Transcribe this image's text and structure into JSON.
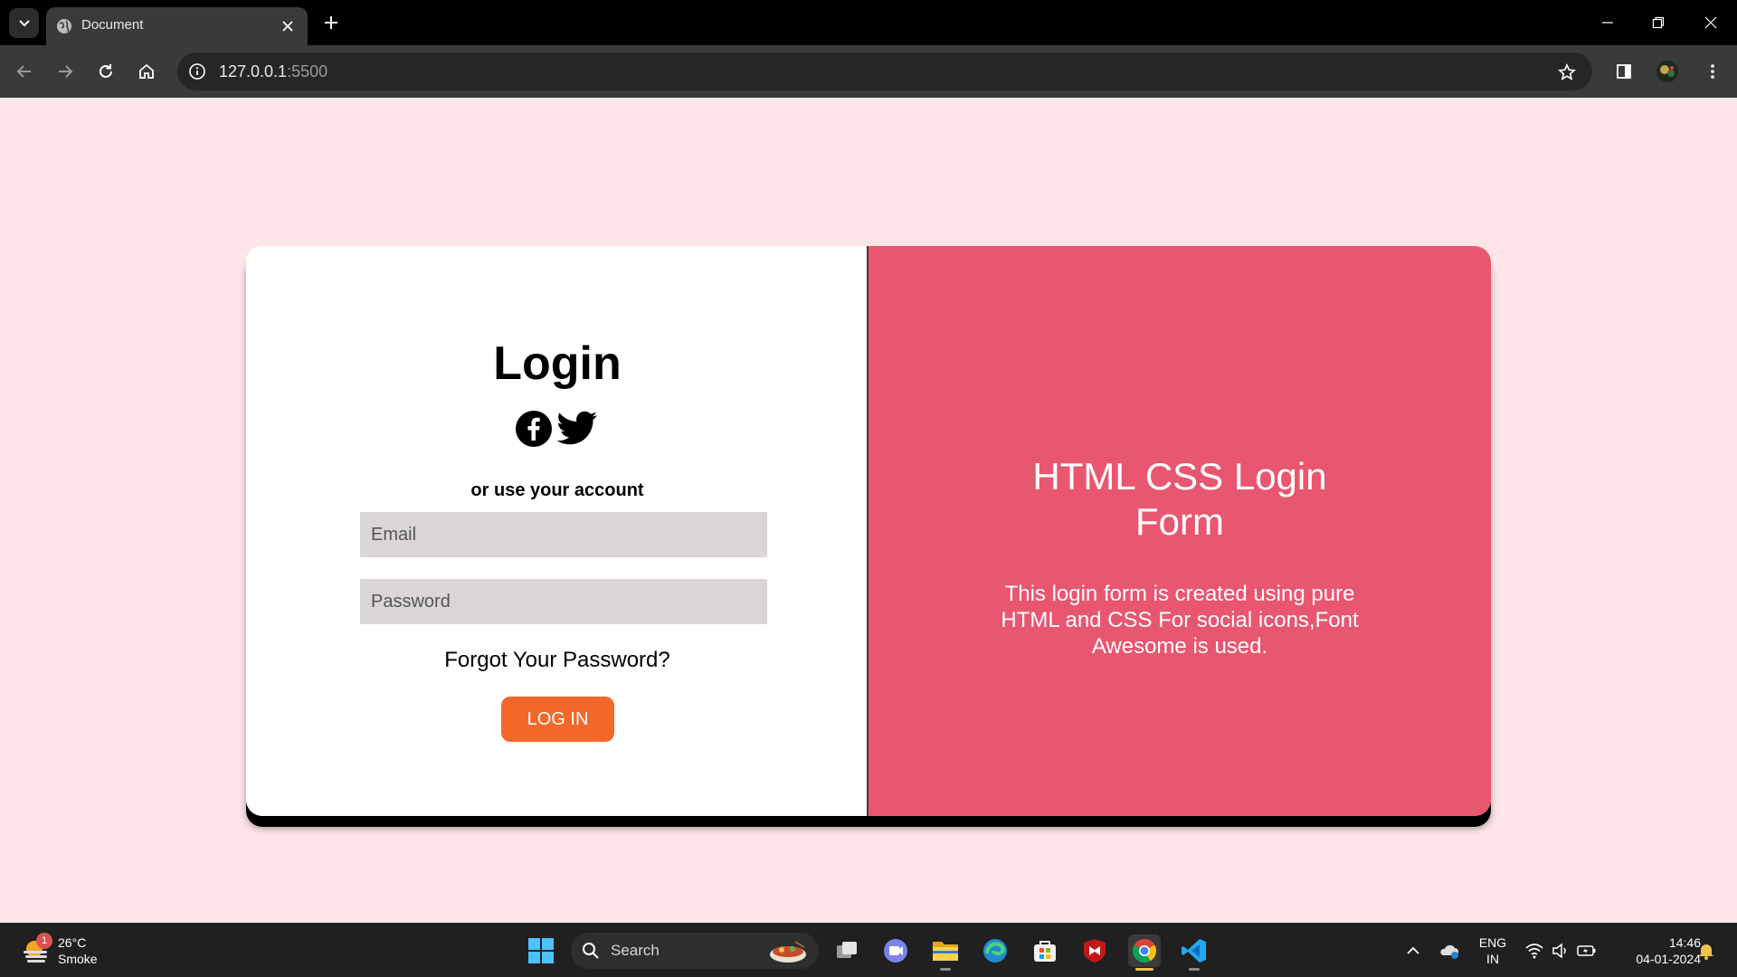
{
  "browser": {
    "tab_title": "Document",
    "url_host": "127.0.0.1",
    "url_port": ":5500"
  },
  "login": {
    "title": "Login",
    "social_icons": [
      "facebook-icon",
      "twitter-icon"
    ],
    "or_text": "or use your account",
    "email_placeholder": "Email",
    "password_placeholder": "Password",
    "forgot_text": "Forgot Your Password?",
    "login_button": "LOG IN"
  },
  "overlay": {
    "title": "HTML CSS Login Form",
    "text": "This login form is created using pure HTML and CSS For social icons,Font Awesome is used."
  },
  "taskbar": {
    "weather_temp": "26°C",
    "weather_condition": "Smoke",
    "weather_badge": "1",
    "search_label": "Search",
    "lang_line1": "ENG",
    "lang_line2": "IN",
    "time": "14:46",
    "date": "04-01-2024"
  },
  "colors": {
    "page_bg": "#fee6e8",
    "accent_panel": "#e9566f",
    "login_button": "#f2682b",
    "input_bg": "#dad6d6"
  }
}
